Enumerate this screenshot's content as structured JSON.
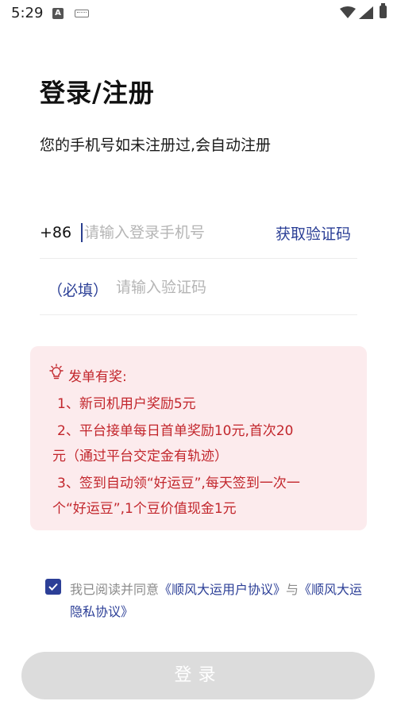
{
  "status_bar": {
    "time": "5:29",
    "icons": [
      "notification-a-icon",
      "keyboard-icon",
      "wifi-icon",
      "signal-icon",
      "battery-icon"
    ]
  },
  "title": "登录/注册",
  "subtitle": "您的手机号如未注册过,会自动注册",
  "phone": {
    "country_code": "+86",
    "placeholder": "请输入登录手机号",
    "value": "",
    "get_code_label": "获取验证码"
  },
  "code": {
    "required_label": "（必填）",
    "placeholder": "请输入验证码",
    "value": ""
  },
  "reward": {
    "title": "发单有奖:",
    "lines": [
      "1、新司机用户奖励5元",
      "2、平台接单每日首单奖励10元,首次20",
      "元（通过平台交定金有轨迹）",
      "3、签到自动领“好运豆”,每天签到一次一",
      "个“好运豆”,1个豆价值现金1元"
    ]
  },
  "agreement": {
    "checked": true,
    "prefix": "我已阅读并同意",
    "user_agreement": "《顺风大运用户协议》",
    "conjunction": "与",
    "privacy_agreement": "《顺风大运隐私协议》"
  },
  "login_button_label": "登录",
  "colors": {
    "accent": "#2c3f97",
    "reward_bg": "#fcebed",
    "reward_text": "#c2262c",
    "button_disabled": "#dcdcdc"
  }
}
